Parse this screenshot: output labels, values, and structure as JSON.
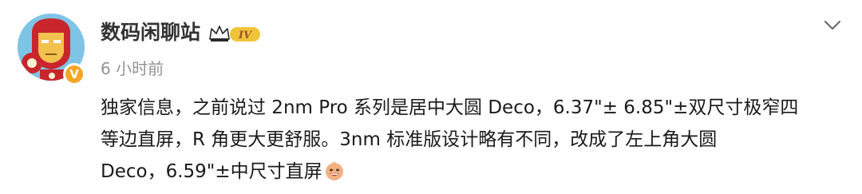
{
  "user": {
    "name": "数码闲聊站",
    "level_badge": "IV",
    "verified_mark": "V",
    "timestamp": "6 小时前",
    "avatar_icon": "iron-man-avatar-icon"
  },
  "post": {
    "lines": [
      "独家信息，之前说过 2nm Pro 系列是居中大圆 Deco，6.37\"± 6.85\"±双尺寸极窄四",
      "等边直屏，R 角更大更舒服。3nm 标准版设计略有不同，改成了左上角大圆",
      "Deco，6.59\"±中尺寸直屏"
    ],
    "trailing_emoji": "grinning-face-emoji"
  },
  "colors": {
    "username": "#333333",
    "timestamp": "#939393",
    "body_text": "#1a1a1a",
    "verified_badge": "#f5a623",
    "level_badge": "#e8a317"
  }
}
